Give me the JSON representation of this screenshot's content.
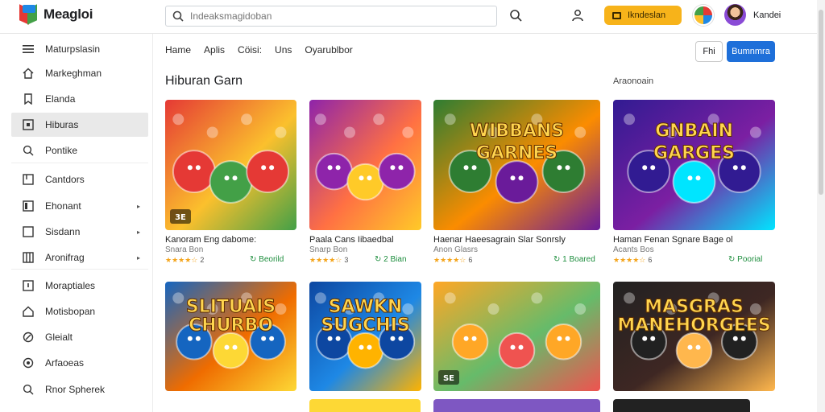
{
  "app": {
    "name": "Meagloi"
  },
  "search": {
    "placeholder": "Indeaksmagidoban"
  },
  "header": {
    "upgrade_label": "Ikndeslan",
    "username": "Kandei"
  },
  "sidebar": {
    "items": [
      {
        "label": "Maturpslasin",
        "icon": "menu-icon"
      },
      {
        "label": "Markeghman",
        "icon": "home-icon"
      },
      {
        "label": "Elanda",
        "icon": "bookmark-icon"
      },
      {
        "label": "Hiburas",
        "icon": "grid-icon",
        "active": true
      },
      {
        "label": "Pontike",
        "icon": "search-icon"
      },
      {
        "label": "Cantdors",
        "icon": "box-icon"
      },
      {
        "label": "Ehonant",
        "icon": "building-icon",
        "chevron": true
      },
      {
        "label": "Sisdann",
        "icon": "square-icon",
        "chevron": true
      },
      {
        "label": "Aronifrag",
        "icon": "columns-icon",
        "chevron": true
      },
      {
        "label": "Moraptiales",
        "icon": "info-icon"
      },
      {
        "label": "Motisbopan",
        "icon": "house-icon"
      },
      {
        "label": "Gleialt",
        "icon": "pencil-icon"
      },
      {
        "label": "Arfaoeas",
        "icon": "pin-icon"
      },
      {
        "label": "Rnor Spherek",
        "icon": "magnifier-icon"
      }
    ]
  },
  "tabs": [
    "Hame",
    "Aplis",
    "Cöisi:",
    "Uns",
    "Oyarublbor"
  ],
  "actions": {
    "outline_label": "Fhi",
    "primary_label": "Bumnmra"
  },
  "section": {
    "title": "Hiburan Garn",
    "see_all": "Araonoain"
  },
  "games": [
    {
      "title": "Kanoram Eng dabome:",
      "subtitle": "Snara Bon",
      "rating": "2",
      "badge": "Beorild",
      "tag": "3E"
    },
    {
      "title": "Paala Cans Iibaedbal",
      "subtitle": "Snarp Bon",
      "rating": "3",
      "badge": "2 Bian",
      "tag": ""
    },
    {
      "title": "Haenar Haeesagrain Slar Sonrsly",
      "subtitle": "Anon Glasrs",
      "rating": "6",
      "badge": "1 Boared",
      "tag": "",
      "art_text": [
        "WIBBANS",
        "GARNES"
      ]
    },
    {
      "title": "Haman Fenan Sgnare Bage ol",
      "subtitle": "Acants Bos",
      "rating": "6",
      "badge": "Poorial",
      "tag": "",
      "art_text": [
        "GNBAIN",
        "GARGES"
      ]
    },
    {
      "title": "",
      "art_text": [
        "SLITUAIS",
        "CHURBO"
      ]
    },
    {
      "title": "",
      "art_text": [
        "SAWKN",
        "SUGCHIS"
      ]
    },
    {
      "title": "",
      "tag": "SE"
    },
    {
      "title": "",
      "art_text": [
        "MASGRAS",
        "MANEHORGEES"
      ]
    }
  ],
  "colors": {
    "accent": "#1e6fd9",
    "upgrade": "#f7b31a",
    "green": "#1e8e3e",
    "star": "#f4a51c"
  }
}
